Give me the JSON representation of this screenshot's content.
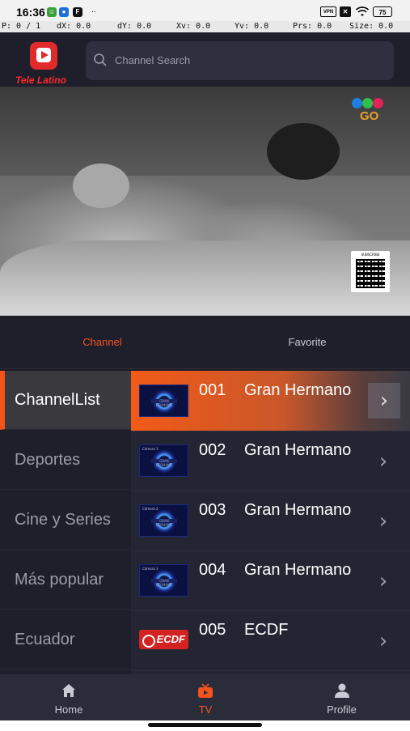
{
  "status_bar": {
    "time": "16:36",
    "vpn_label": "VPN",
    "battery_level": "75"
  },
  "pointer_info": {
    "p": "P: 0 / 1",
    "dx": "dX: 0.0",
    "dy": "dY: 0.0",
    "xv": "Xv: 0.0",
    "yv": "Yv: 0.0",
    "prs": "Prs: 0.0",
    "size": "Size: 0.0"
  },
  "header": {
    "logo_text": "Tele Latino",
    "search_placeholder": "Channel Search"
  },
  "video": {
    "qr_title": "SUBSCRIBE",
    "channel_bug_text": "GO"
  },
  "tabs": [
    {
      "label": "Channel",
      "active": true
    },
    {
      "label": "Favorite",
      "active": false
    }
  ],
  "categories": [
    {
      "label": "ChannelList",
      "active": true
    },
    {
      "label": "Deportes",
      "active": false
    },
    {
      "label": "Cine y Series",
      "active": false
    },
    {
      "label": "Más popular",
      "active": false
    },
    {
      "label": "Ecuador",
      "active": false
    }
  ],
  "channels": [
    {
      "number": "001",
      "name": "Gran Hermano",
      "thumb": "gran-hermano",
      "thumb_caption": "GRAN HERMANO",
      "active": true
    },
    {
      "number": "002",
      "name": "Gran Hermano",
      "thumb": "gran-hermano",
      "thumb_caption": "GRAN HERMANO",
      "thumb_tag": "Cámara 1",
      "active": false
    },
    {
      "number": "003",
      "name": "Gran Hermano",
      "thumb": "gran-hermano",
      "thumb_caption": "GRAN HERMANO",
      "thumb_tag": "Cámara 2",
      "active": false
    },
    {
      "number": "004",
      "name": "Gran Hermano",
      "thumb": "gran-hermano",
      "thumb_caption": "GRAN HERMANO",
      "thumb_tag": "Cámara 3",
      "active": false
    },
    {
      "number": "005",
      "name": "ECDF",
      "thumb": "ecdf",
      "thumb_caption": "ECDF",
      "active": false
    }
  ],
  "bottom_nav": [
    {
      "label": "Home",
      "icon": "home-icon",
      "active": false
    },
    {
      "label": "TV",
      "icon": "tv-icon",
      "active": true
    },
    {
      "label": "Profile",
      "icon": "profile-icon",
      "active": false
    }
  ],
  "colors": {
    "accent": "#f4531c",
    "background": "#1b1c26",
    "panel": "#232533"
  }
}
